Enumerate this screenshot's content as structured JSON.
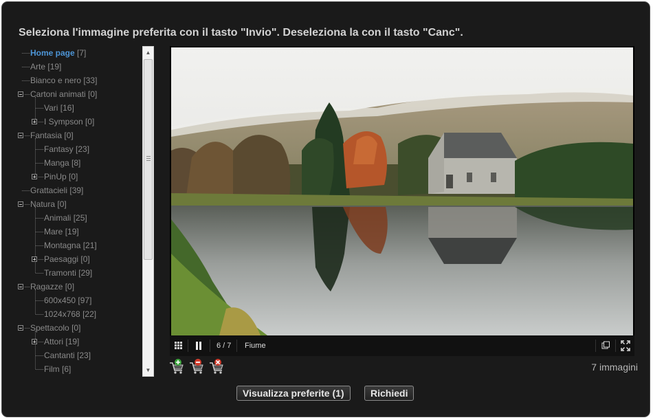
{
  "title": "Seleziona l'immagine preferita con il tasto \"Invio\". Deseleziona la con il tasto \"Canc\".",
  "tree": [
    {
      "label": "Home page",
      "count": "[7]",
      "level": 0,
      "selected": true
    },
    {
      "label": "Arte",
      "count": "[19]",
      "level": 0
    },
    {
      "label": "Bianco e nero",
      "count": "[33]",
      "level": 0
    },
    {
      "label": "Cartoni animati",
      "count": "[0]",
      "level": 0,
      "expander": "minus"
    },
    {
      "label": "Vari",
      "count": "[16]",
      "level": 1
    },
    {
      "label": "I Sympson",
      "count": "[0]",
      "level": 1,
      "expander": "plus"
    },
    {
      "label": "Fantasia",
      "count": "[0]",
      "level": 0,
      "expander": "minus"
    },
    {
      "label": "Fantasy",
      "count": "[23]",
      "level": 1
    },
    {
      "label": "Manga",
      "count": "[8]",
      "level": 1
    },
    {
      "label": "PinUp",
      "count": "[0]",
      "level": 1,
      "expander": "plus"
    },
    {
      "label": "Grattacieli",
      "count": "[39]",
      "level": 0
    },
    {
      "label": "Natura",
      "count": "[0]",
      "level": 0,
      "expander": "minus"
    },
    {
      "label": "Animali",
      "count": "[25]",
      "level": 1
    },
    {
      "label": "Mare",
      "count": "[19]",
      "level": 1
    },
    {
      "label": "Montagna",
      "count": "[21]",
      "level": 1
    },
    {
      "label": "Paesaggi",
      "count": "[0]",
      "level": 1,
      "expander": "plus"
    },
    {
      "label": "Tramonti",
      "count": "[29]",
      "level": 1
    },
    {
      "label": "Ragazze",
      "count": "[0]",
      "level": 0,
      "expander": "minus"
    },
    {
      "label": "600x450",
      "count": "[97]",
      "level": 1
    },
    {
      "label": "1024x768",
      "count": "[22]",
      "level": 1
    },
    {
      "label": "Spettacolo",
      "count": "[0]",
      "level": 0,
      "expander": "minus"
    },
    {
      "label": "Attori",
      "count": "[19]",
      "level": 1,
      "expander": "plus"
    },
    {
      "label": "Cantanti",
      "count": "[23]",
      "level": 1
    },
    {
      "label": "Film",
      "count": "[6]",
      "level": 1
    }
  ],
  "viewer": {
    "counter": "6 / 7",
    "caption": "Fiume"
  },
  "favorites": {
    "icons": [
      "cart-add-icon",
      "cart-remove-icon",
      "cart-clear-icon"
    ]
  },
  "image_count": "7 immagini",
  "buttons": {
    "show_favorites": "Visualizza preferite (1)",
    "request": "Richiedi"
  }
}
